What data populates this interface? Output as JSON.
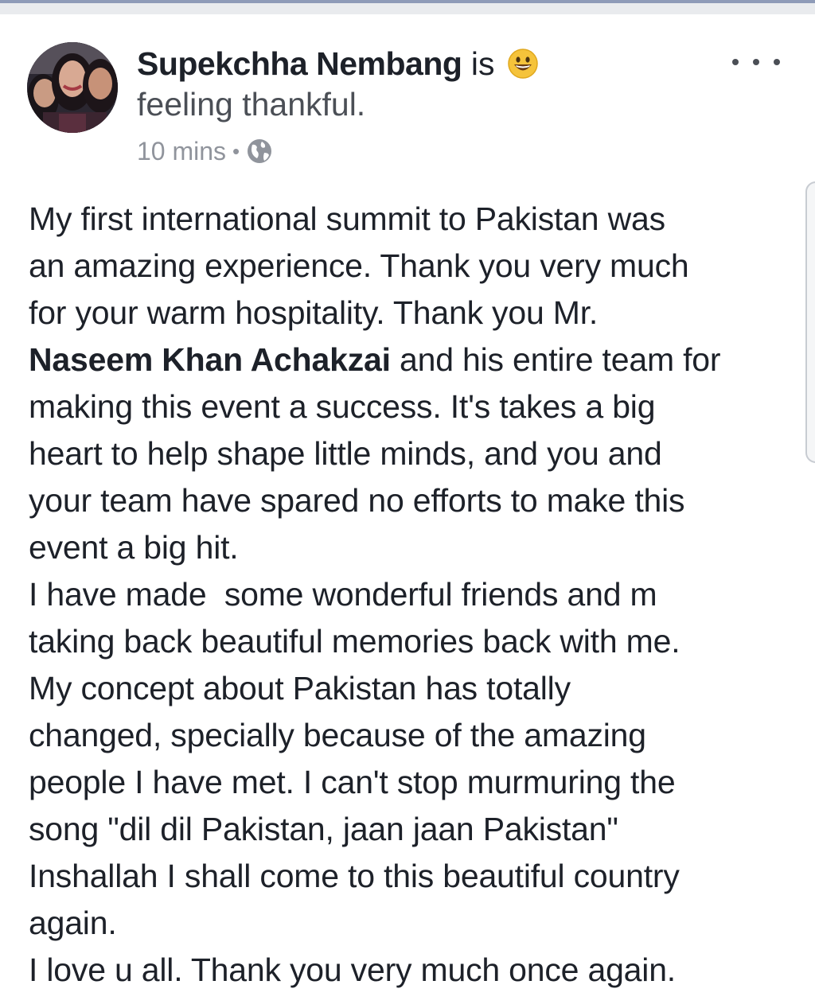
{
  "post": {
    "author": "Supekchha Nembang",
    "is_word": "is",
    "feeling": "feeling thankful.",
    "time": "10 mins",
    "meta_separator": "•",
    "privacy_icon": "globe-icon",
    "feeling_icon": "smiling-face-icon",
    "more_icon": "more-dots-icon",
    "body_lines": [
      "My first international summit to Pakistan was",
      "an amazing experience. Thank you very much",
      "for your warm hospitality. Thank you Mr.",
      "and his entire team for",
      "making this event a success. It's takes a big",
      "heart to help shape little minds, and you and",
      "your team have spared no efforts to make this",
      "event a big hit.",
      "I have made  some wonderful friends and m",
      "taking back beautiful memories back with me.",
      "My concept about Pakistan has totally",
      "changed, specially because of the amazing",
      "people I have met. I can't stop murmuring the",
      "song \"dil dil Pakistan, jaan jaan Pakistan\"",
      "Inshallah I shall come to this beautiful country",
      "again.",
      "I love u all. Thank you very much once again."
    ],
    "tagged_name": "Naseem Khan Achakzai"
  },
  "colors": {
    "text_primary": "#1d2129",
    "text_secondary": "#90949c",
    "top_bar": "#8e9bb8"
  }
}
